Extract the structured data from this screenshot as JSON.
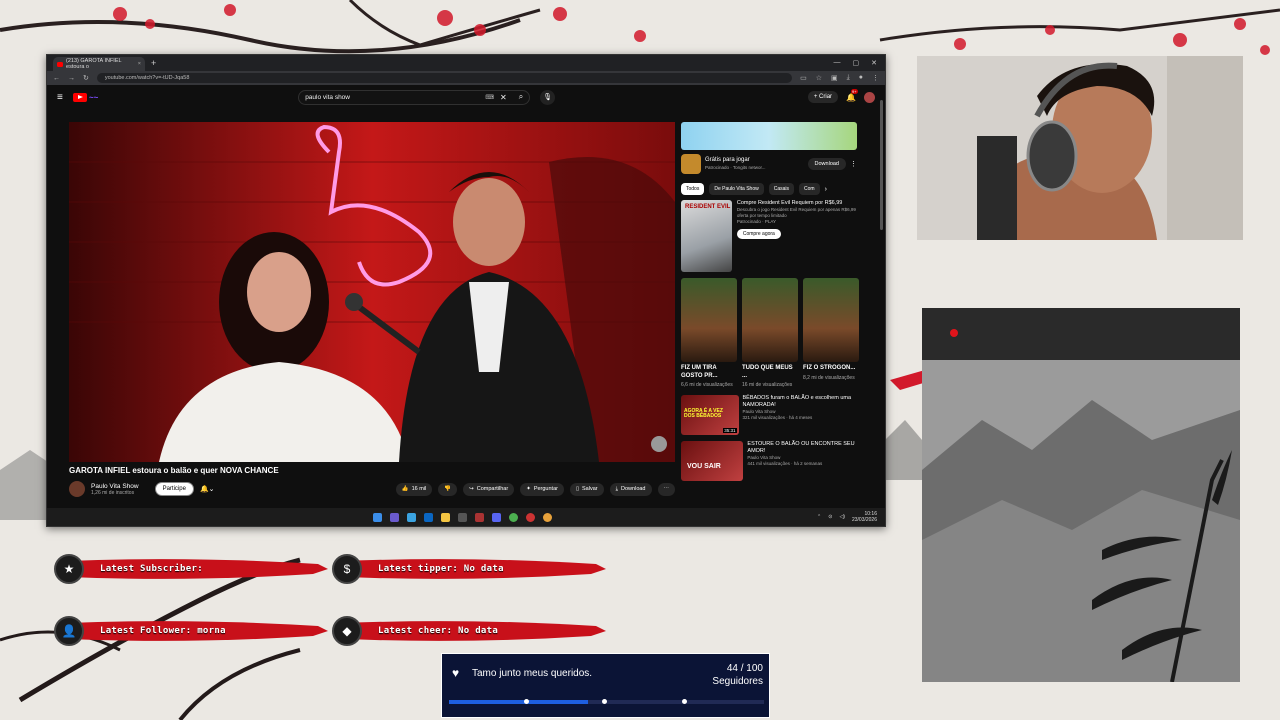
{
  "browser": {
    "tab_title": "(213) GAROTA INFIEL estoura o",
    "url": "youtube.com/watch?v=-tUD-Jqa58"
  },
  "youtube": {
    "search_query": "paulo vita show",
    "create_label": "Criar",
    "notif_badge": "9+",
    "video_title": "GAROTA INFIEL estoura o balão e quer NOVA CHANCE",
    "channel_name": "Paulo Vita Show",
    "subscribers": "1,26 mi de inscritos",
    "join_label": "Participe",
    "likes": "16 mil",
    "share_label": "Compartilhar",
    "ask_label": "Perguntar",
    "save_label": "Salvar",
    "download_label": "Download",
    "ad": {
      "title": "Grátis para jogar",
      "sponsor": "Patrocinado · Tongits networ...",
      "button": "Download"
    },
    "chips": [
      "Todos",
      "De Paulo Vita Show",
      "Casais",
      "Com"
    ],
    "promo": {
      "thumb_label": "RESIDENT EVIL",
      "title": "Compre Resident Evil Requiem por R$6,99",
      "desc": "Descubra o jogo Resident Evil Requiem por apenas R$6,99 oferta por tempo limitado",
      "sponsor": "Patrocinado · PLAY",
      "button": "Compre agora"
    },
    "shorts": [
      {
        "title": "FIZ UM TIRA GOSTO PR...",
        "views": "6,6 mi de visualizações"
      },
      {
        "title": "TUDO QUE MEUS ...",
        "views": "16 mi de visualizações"
      },
      {
        "title": "FIZ O STROGON...",
        "views": "8,2 mi de visualizações"
      }
    ],
    "videos": [
      {
        "title": "BÊBADOS furam o BALÃO e escolhem uma NAMORADA!",
        "channel": "Paulo Vita Show",
        "meta": "321 mil visualizações · há 4 meses",
        "duration": "35:31",
        "thumb_text": "AGORA É A VEZ DOS BÊBADOS"
      },
      {
        "title": "ESTOURE O BALÃO OU ENCONTRE SEU AMOR!",
        "channel": "Paulo Vita Show",
        "meta": "441 mil visualizações · há 2 semanas",
        "thumb_text": "VOU SAIR"
      }
    ]
  },
  "taskbar": {
    "time": "10:16",
    "date": "23/03/2026"
  },
  "alerts": {
    "subscriber": "Latest Subscriber:",
    "tipper": "Latest tipper: No data",
    "follower": "Latest Follower: morna",
    "cheer": "Latest cheer: No data"
  },
  "goal": {
    "title": "Tamo junto meus queridos.",
    "count": "44 / 100",
    "unit": "Seguidores",
    "progress": 0.44
  },
  "colors": {
    "accent_red": "#c8101a",
    "goal_bg": "#0b1436",
    "goal_fill": "#1e5fe0"
  }
}
